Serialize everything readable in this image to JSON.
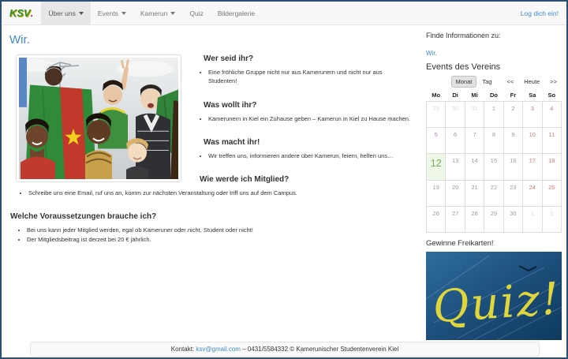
{
  "navbar": {
    "brand": "KSV",
    "brand_dot": ".",
    "items": [
      {
        "label": "Über uns",
        "has_caret": true,
        "active": true
      },
      {
        "label": "Events",
        "has_caret": true,
        "active": false
      },
      {
        "label": "Kamerun",
        "has_caret": true,
        "active": false
      },
      {
        "label": "Quiz",
        "has_caret": false,
        "active": false
      },
      {
        "label": "Bildergalerie",
        "has_caret": false,
        "active": false
      }
    ],
    "login_label": "Log dich ein!"
  },
  "main": {
    "page_title": "Wir.",
    "sections": [
      {
        "heading": "Wer seid ihr?",
        "bullets": [
          "Eine fröhliche Gruppe nicht nur aus Kamerunern und nicht nur aus Studenten!"
        ]
      },
      {
        "heading": "Was wollt ihr?",
        "bullets": [
          "Kamerunern in Kiel ein Zuhause geben – Kamerun in Kiel zu Hause machen."
        ]
      },
      {
        "heading": "Was macht ihr!",
        "bullets": [
          "Wir treffen uns, informieren andere über Kamerun, feiern, helfen uns…"
        ]
      },
      {
        "heading": "Wie werde ich Mitglied?",
        "bullets": [
          "Schreibe uns eine Email, ruf uns an, komm zur nächsten Veranstaltung oder triff uns auf dem Campus."
        ]
      },
      {
        "heading": "Welche Voraussetzungen brauche ich?",
        "bullets": [
          "Bei uns kann jeder Mitglied werden, egal ob Kameruner oder nicht, Student oder nicht!",
          "Der Mitgliedsbeitrag ist derzeit bei 20 € jährlich."
        ]
      }
    ]
  },
  "sidebar": {
    "find_info_title": "Finde Informationen zu:",
    "find_info_link": "Wir.",
    "events_title": "Events des Vereins",
    "calendar": {
      "view_buttons": [
        "Monat",
        "Tag"
      ],
      "active_view": "Monat",
      "nav_buttons": [
        "<<",
        "Heute",
        ">>"
      ],
      "day_headers": [
        "Mo",
        "Di",
        "Mi",
        "Do",
        "Fr",
        "Sa",
        "So"
      ],
      "today_day": "12",
      "event_day": "5",
      "weeks": [
        [
          {
            "n": "29",
            "t": "out"
          },
          {
            "n": "30",
            "t": "out"
          },
          {
            "n": "31",
            "t": "out"
          },
          {
            "n": "1",
            "t": ""
          },
          {
            "n": "2",
            "t": ""
          },
          {
            "n": "3",
            "t": "weekend"
          },
          {
            "n": "4",
            "t": "weekend"
          }
        ],
        [
          {
            "n": "5",
            "t": "event"
          },
          {
            "n": "6",
            "t": ""
          },
          {
            "n": "7",
            "t": ""
          },
          {
            "n": "8",
            "t": ""
          },
          {
            "n": "9",
            "t": ""
          },
          {
            "n": "10",
            "t": "weekend"
          },
          {
            "n": "11",
            "t": "weekend"
          }
        ],
        [
          {
            "n": "12",
            "t": "today"
          },
          {
            "n": "13",
            "t": ""
          },
          {
            "n": "14",
            "t": ""
          },
          {
            "n": "15",
            "t": ""
          },
          {
            "n": "16",
            "t": ""
          },
          {
            "n": "17",
            "t": "weekend"
          },
          {
            "n": "18",
            "t": "weekend"
          }
        ],
        [
          {
            "n": "19",
            "t": ""
          },
          {
            "n": "20",
            "t": ""
          },
          {
            "n": "21",
            "t": ""
          },
          {
            "n": "22",
            "t": ""
          },
          {
            "n": "23",
            "t": ""
          },
          {
            "n": "24",
            "t": "weekend"
          },
          {
            "n": "25",
            "t": "weekend"
          }
        ],
        [
          {
            "n": "26",
            "t": ""
          },
          {
            "n": "27",
            "t": ""
          },
          {
            "n": "28",
            "t": ""
          },
          {
            "n": "29",
            "t": ""
          },
          {
            "n": "30",
            "t": ""
          },
          {
            "n": "1",
            "t": "out weekend"
          },
          {
            "n": "2",
            "t": "out weekend"
          }
        ]
      ]
    },
    "quiz_title": "Gewinne Freikarten!",
    "quiz_image_text": "Quiz!"
  },
  "footer": {
    "prefix": "Kontakt:",
    "email": "ksv@gmail.com",
    "suffix": "– 0431/5584332 © Kamerunischer Studentenverein Kiel"
  },
  "colors": {
    "link_blue": "#428bca",
    "navbar_bg": "#f8f8f8",
    "nav_active_bg": "#e7e7e7",
    "today_green": "#76a95c",
    "today_bg": "#eef7e8",
    "weekend_red": "#cc7a76",
    "event_purple": "#b57eb5",
    "brand_green": "#2e8b2e",
    "page_border": "#2c4f74"
  }
}
